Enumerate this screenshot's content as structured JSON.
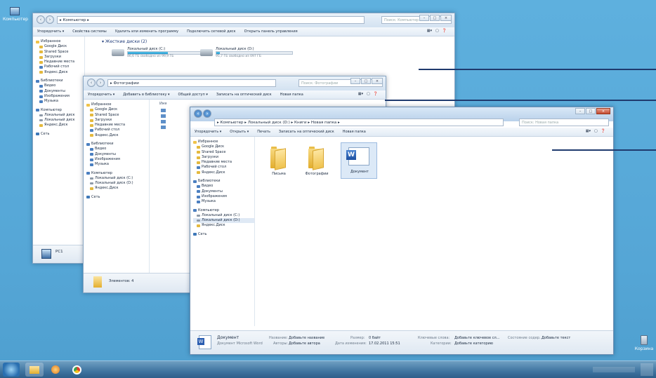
{
  "desktop": {
    "icon_computer": "Компьютер",
    "icon_recycle": "Корзина"
  },
  "win1": {
    "address": "▸ Компьютер ▸",
    "search_placeholder": "Поиск: Компьютер",
    "toolbar": [
      "Упорядочить ▾",
      "Свойства системы",
      "Удалить или изменить программу",
      "Подключить сетевой диск",
      "Открыть панель управления"
    ],
    "nav": [
      "Избранное",
      "Google Диск",
      "Shared Space",
      "Загрузки",
      "Недавние места",
      "Рабочий стол",
      "Яндекс.Диск",
      "Библиотеки",
      "Видео",
      "Документы",
      "Изображения",
      "Музыка",
      "Компьютер",
      "Локальный диск",
      "Локальный диск",
      "Яндекс.Диск",
      "Сеть"
    ],
    "section": "Жесткие диски (2)",
    "drive_c": "Локальный диск (C:)",
    "drive_c_free": "46,6 ГБ свободно из 99,9 ГБ",
    "drive_d": "Локальный диск (D:)",
    "drive_d_free": "95,7 ГБ свободно из 097 ГБ",
    "drive_c_fill": 0.53,
    "drive_d_fill": 0.05,
    "status_name": "PC1"
  },
  "win2": {
    "address": "▸ Фотографии",
    "search_placeholder": "Поиск: Фотографии",
    "toolbar": [
      "Упорядочить ▾",
      "Добавить в библиотеку ▾",
      "Общий доступ ▾",
      "Записать на оптический диск",
      "Новая папка"
    ],
    "nav": [
      "Избранное",
      "Google Диск",
      "Shared Space",
      "Загрузки",
      "Недавние места",
      "Рабочий стол",
      "Яндекс.Диск",
      "Библиотеки",
      "Видео",
      "Документы",
      "Изображения",
      "Музыка",
      "Компьютер",
      "Локальный диск (C:)",
      "Локальный диск (D:)",
      "Яндекс.Диск",
      "Сеть"
    ],
    "col_header": "Имя",
    "status": "Элементов: 4"
  },
  "win3": {
    "address": "▸ Компьютер ▸ Локальный диск (D:) ▸ Книги ▸ Новая папка ▸",
    "search_placeholder": "Поиск: Новая папка",
    "toolbar": [
      "Упорядочить ▾",
      "Открыть ▾",
      "Печать",
      "Записать на оптический диск",
      "Новая папка"
    ],
    "nav": [
      "Избранное",
      "Google Диск",
      "Shared Space",
      "Загрузки",
      "Недавние места",
      "Рабочий стол",
      "Яндекс.Диск",
      "Библиотеки",
      "Видео",
      "Документы",
      "Изображения",
      "Музыка",
      "Компьютер",
      "Локальный диск (C:)",
      "Локальный диск (D:)",
      "Яндекс.Диск",
      "Сеть"
    ],
    "items": [
      "Письма",
      "Фотографии",
      "Документ"
    ],
    "details": {
      "name": "Документ",
      "type": "Документ Microsoft Word",
      "title_label": "Название:",
      "title_value": "Добавьте название",
      "authors_label": "Авторы:",
      "authors_value": "Добавьте автора",
      "size_label": "Размер:",
      "size_value": "0 байт",
      "modified_label": "Дата изменения:",
      "modified_value": "17.02.2011 15:51",
      "keywords_label": "Ключевые слова:",
      "keywords_value": "Добавьте ключевое сл...",
      "category_label": "Категории:",
      "category_value": "Добавьте категорию",
      "content_label": "Состояние содер...",
      "content_value": "Добавьте текст"
    }
  }
}
